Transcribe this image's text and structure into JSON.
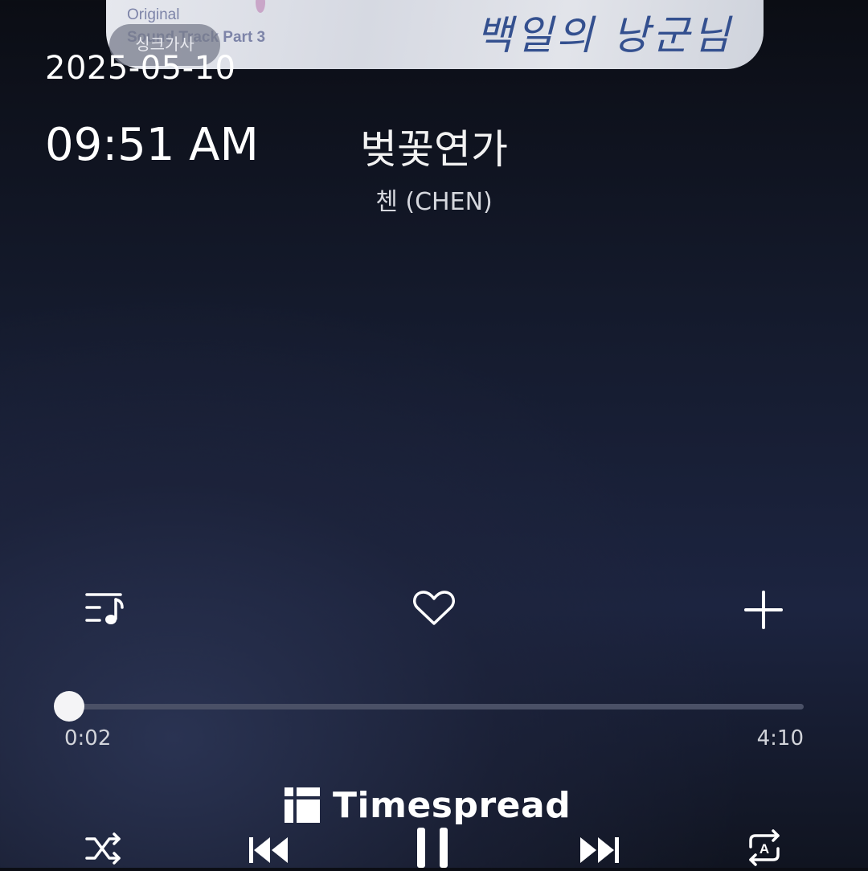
{
  "album_art": {
    "line1": "Original",
    "line2": "Sound Track Part 3",
    "title_calligraphy": "백일의 낭군님"
  },
  "lyrics_badge": "싱크가사",
  "overlay": {
    "date": "2025-05-10",
    "time": "09:51 AM"
  },
  "track": {
    "title": "벚꽃연가",
    "artist": "첸 (CHEN)"
  },
  "actions": {
    "playlist_icon": "playlist-icon",
    "like_icon": "heart-icon",
    "add_icon": "plus-icon"
  },
  "progress": {
    "elapsed": "0:02",
    "duration": "4:10",
    "fraction": 0.008
  },
  "watermark": "Timespread",
  "controls": {
    "shuffle_icon": "shuffle-icon",
    "previous_icon": "skip-previous-icon",
    "play_pause_icon": "pause-icon",
    "next_icon": "skip-next-icon",
    "repeat_icon": "repeat-icon"
  }
}
